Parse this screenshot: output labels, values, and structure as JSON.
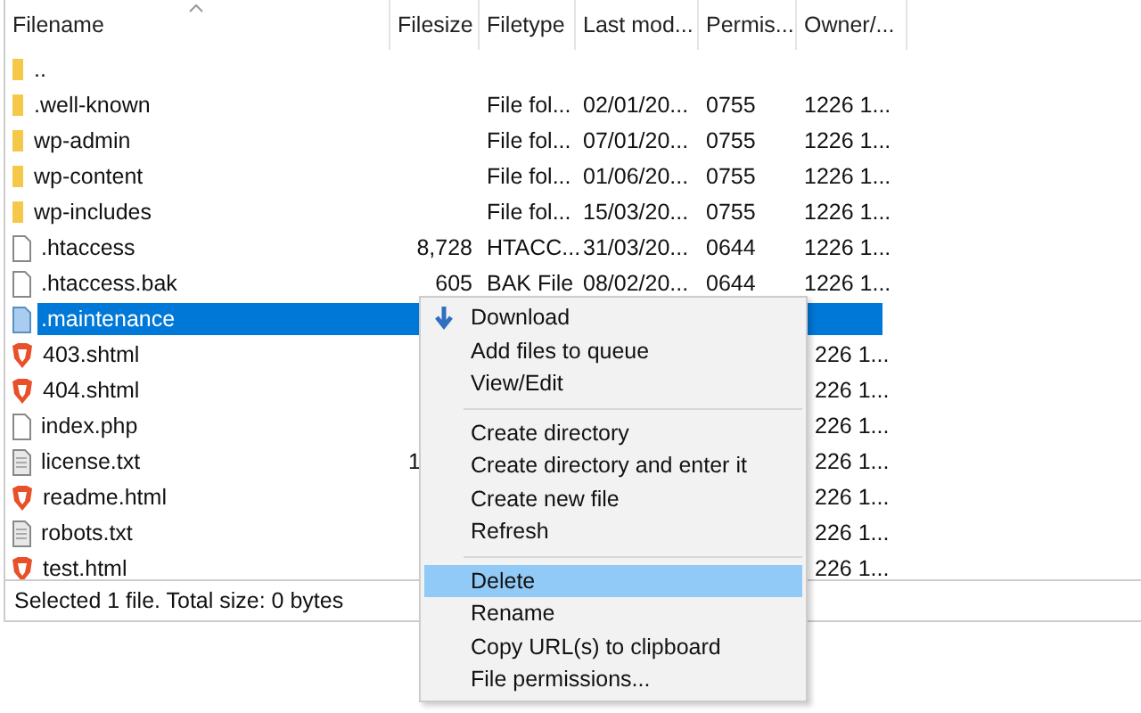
{
  "columns": [
    {
      "label": "Filename"
    },
    {
      "label": "Filesize"
    },
    {
      "label": "Filetype"
    },
    {
      "label": "Last mod..."
    },
    {
      "label": "Permis..."
    },
    {
      "label": "Owner/..."
    }
  ],
  "rows": [
    {
      "kind": "folder",
      "name": "..",
      "selected": false
    },
    {
      "kind": "folder",
      "name": ".well-known",
      "type": "File fol...",
      "modified": "02/01/20...",
      "perms": "0755",
      "owner": "1226 1...",
      "selected": false
    },
    {
      "kind": "folder",
      "name": "wp-admin",
      "type": "File fol...",
      "modified": "07/01/20...",
      "perms": "0755",
      "owner": "1226 1...",
      "selected": false
    },
    {
      "kind": "folder",
      "name": "wp-content",
      "type": "File fol...",
      "modified": "01/06/20...",
      "perms": "0755",
      "owner": "1226 1...",
      "selected": false
    },
    {
      "kind": "folder",
      "name": "wp-includes",
      "type": "File fol...",
      "modified": "15/03/20...",
      "perms": "0755",
      "owner": "1226 1...",
      "selected": false
    },
    {
      "kind": "file",
      "name": ".htaccess",
      "size": "8,728",
      "type": "HTACC...",
      "modified": "31/03/20...",
      "perms": "0644",
      "owner": "1226 1...",
      "selected": false
    },
    {
      "kind": "file",
      "name": ".htaccess.bak",
      "size": "605",
      "type": "BAK File",
      "modified": "08/02/20...",
      "perms": "0644",
      "owner": "1226 1...",
      "selected": false
    },
    {
      "kind": "doc",
      "name": ".maintenance",
      "selected": true
    },
    {
      "kind": "html",
      "name": "403.shtml",
      "owner": "226 1...",
      "selected": false
    },
    {
      "kind": "html",
      "name": "404.shtml",
      "owner": "226 1...",
      "selected": false
    },
    {
      "kind": "file",
      "name": "index.php",
      "owner": "226 1...",
      "selected": false
    },
    {
      "kind": "text",
      "name": "license.txt",
      "size": "1",
      "owner": "226 1...",
      "selected": false
    },
    {
      "kind": "html",
      "name": "readme.html",
      "owner": "226 1...",
      "selected": false
    },
    {
      "kind": "text",
      "name": "robots.txt",
      "owner": "226 1...",
      "selected": false
    },
    {
      "kind": "html",
      "name": "test.html",
      "owner": "226 1...",
      "selected": false
    }
  ],
  "status_bar": "Selected 1 file. Total size: 0 bytes",
  "context_menu": [
    {
      "kind": "download",
      "label": "Download",
      "selected": false
    },
    {
      "kind": "item",
      "label": "Add files to queue",
      "selected": false
    },
    {
      "kind": "item",
      "label": "View/Edit",
      "selected": false
    },
    {
      "kind": "separator"
    },
    {
      "kind": "item",
      "label": "Create directory",
      "selected": false
    },
    {
      "kind": "item",
      "label": "Create directory and enter it",
      "selected": false
    },
    {
      "kind": "item",
      "label": "Create new file",
      "selected": false
    },
    {
      "kind": "item",
      "label": "Refresh",
      "selected": false
    },
    {
      "kind": "separator"
    },
    {
      "kind": "item",
      "label": "Delete",
      "selected": true
    },
    {
      "kind": "item",
      "label": "Rename",
      "selected": false
    },
    {
      "kind": "item",
      "label": "Copy URL(s) to clipboard",
      "selected": false
    },
    {
      "kind": "item",
      "label": "File permissions...",
      "selected": false
    }
  ]
}
